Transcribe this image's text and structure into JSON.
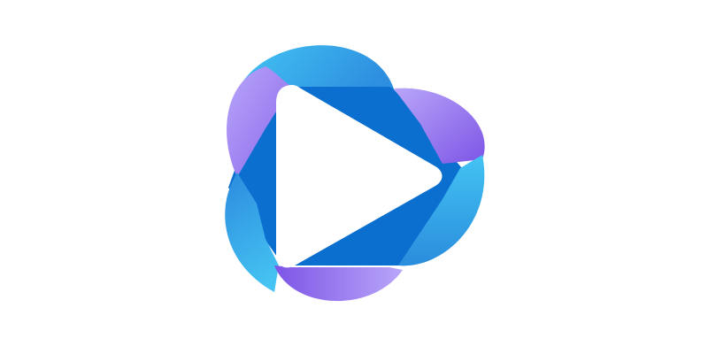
{
  "logo": {
    "icon": "play-icon",
    "colors": {
      "blue_light": "#43C4F3",
      "blue_mid": "#2E9BE0",
      "blue_dark": "#0B6FD0",
      "purple_light": "#B9A6F9",
      "purple_mid": "#9A7DF0",
      "purple_dark": "#7D55E6",
      "background": "#FFFFFF"
    }
  }
}
